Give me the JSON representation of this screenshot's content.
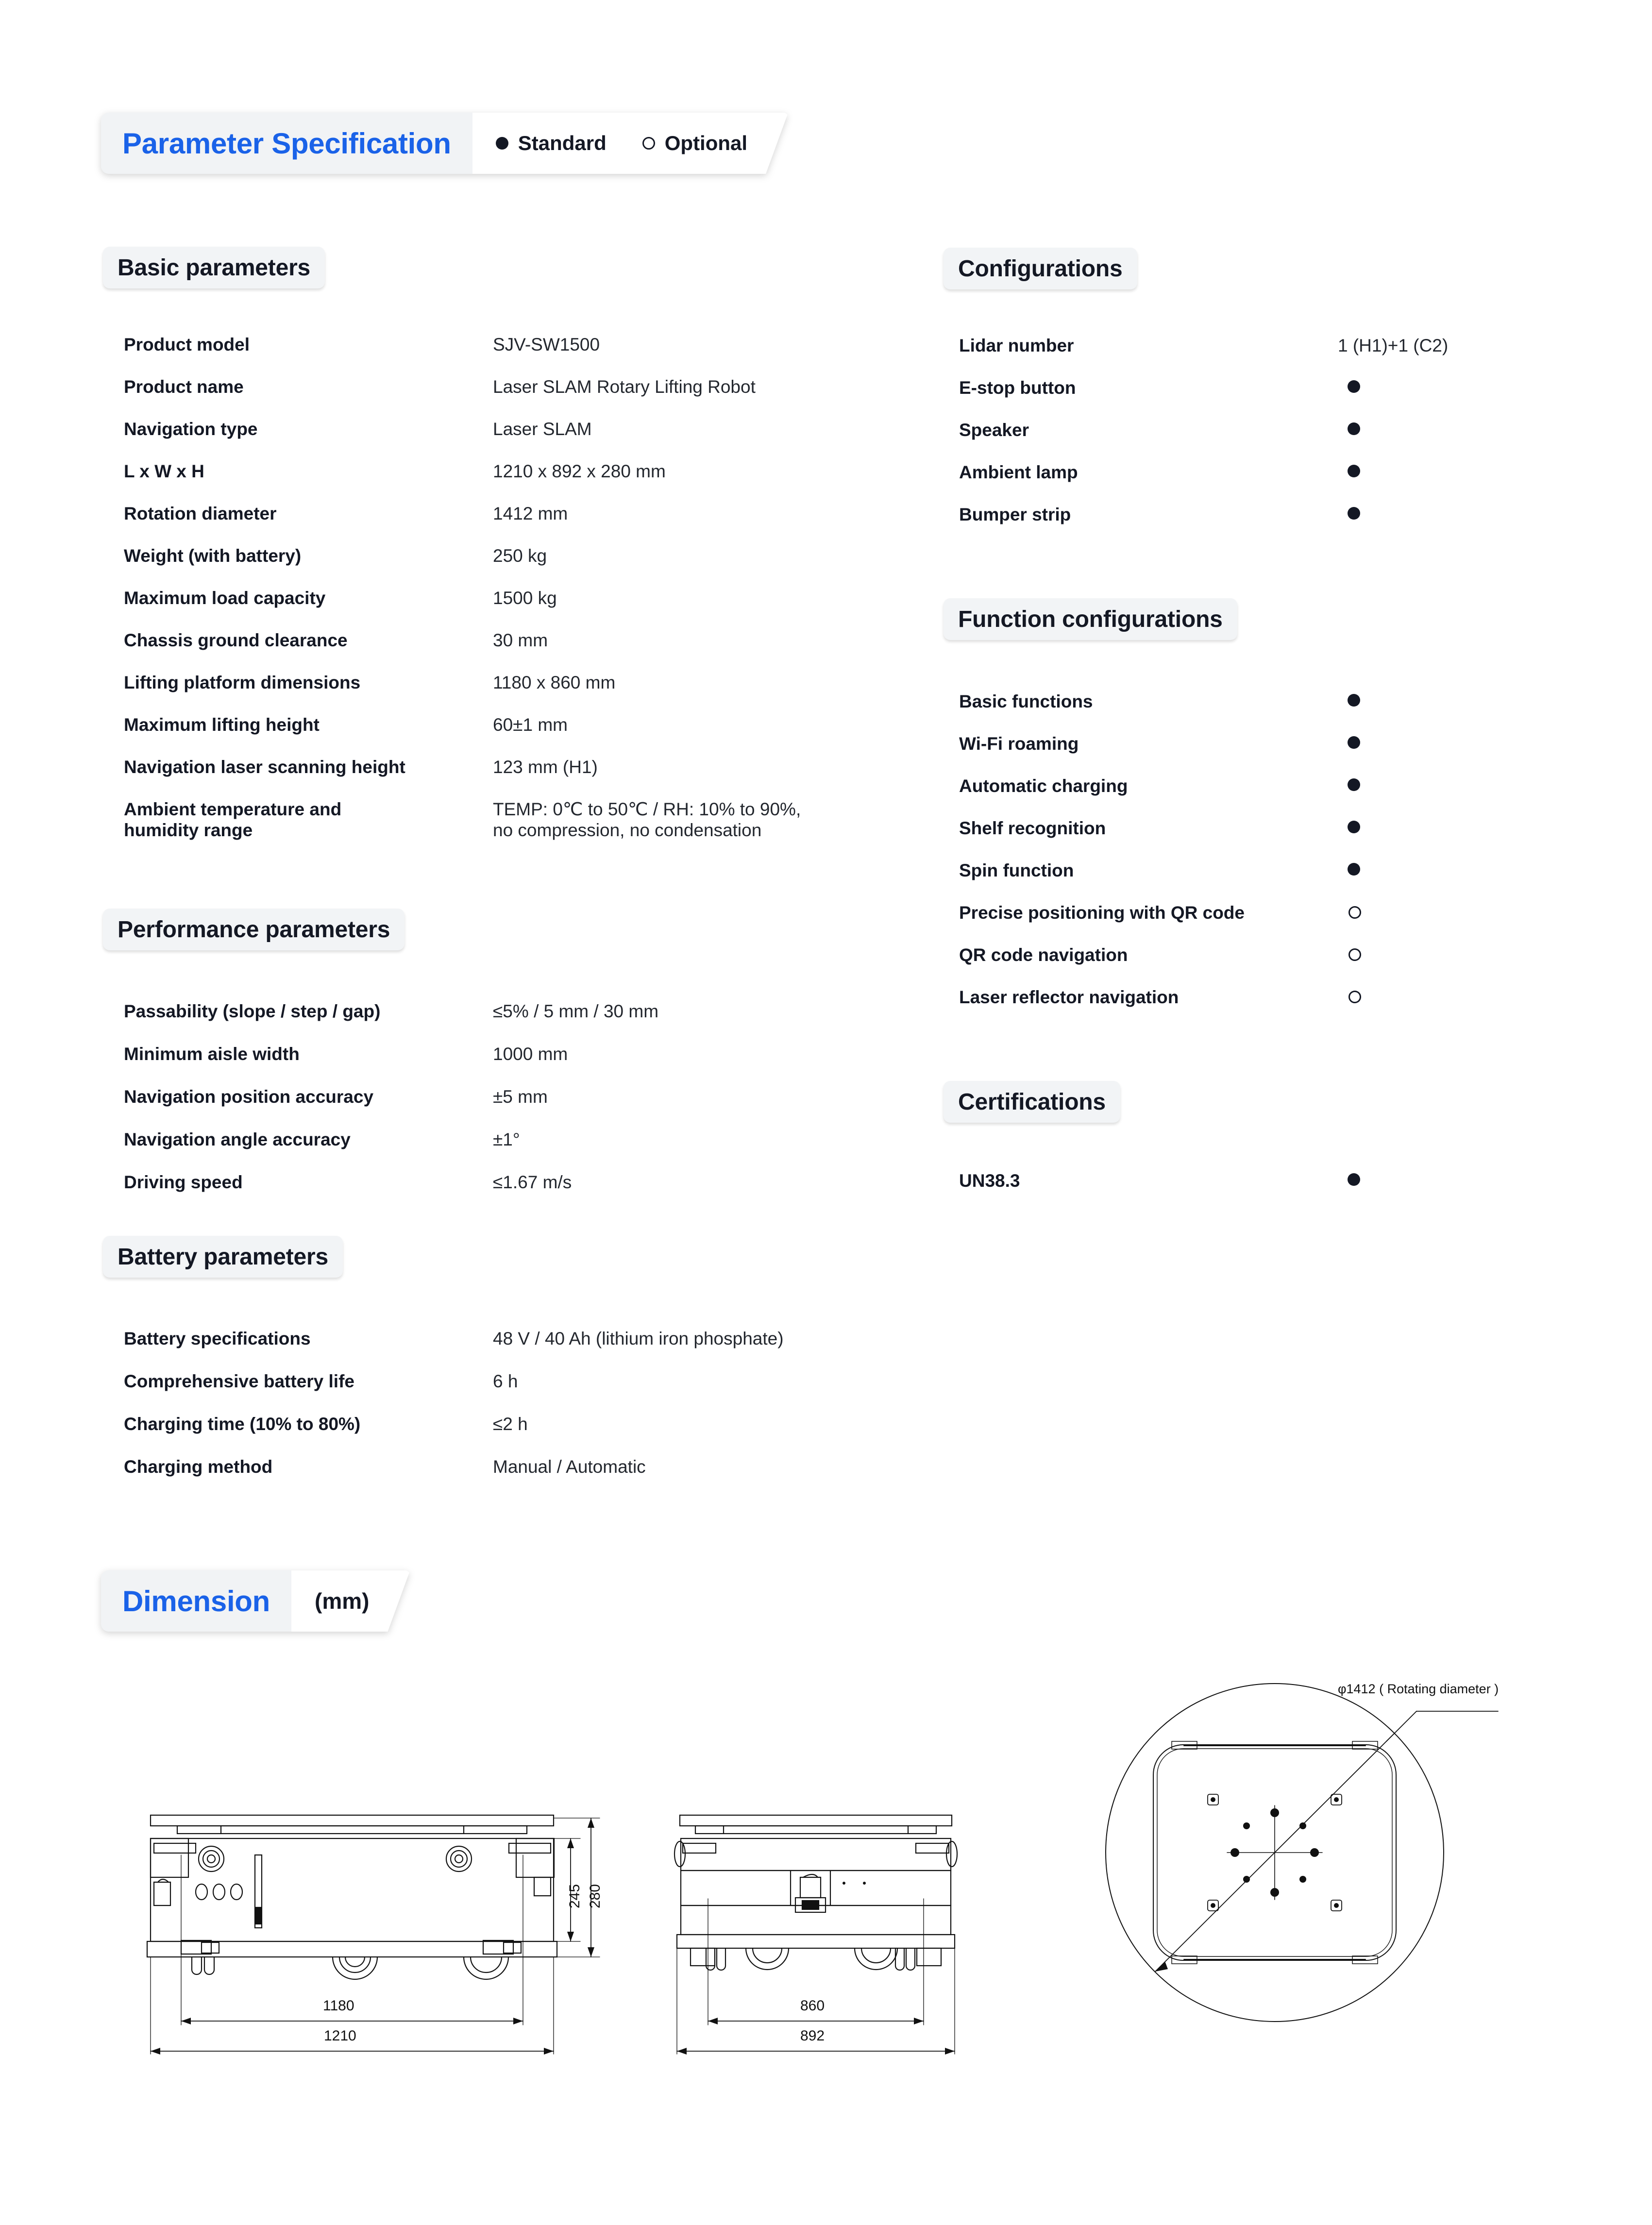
{
  "header": {
    "title": "Parameter Specification",
    "legend": [
      {
        "marker": "filled",
        "label": "Standard"
      },
      {
        "marker": "hollow",
        "label": "Optional"
      }
    ]
  },
  "sections": {
    "basic": {
      "title": "Basic parameters",
      "rows": [
        {
          "label": "Product model",
          "value": "SJV-SW1500"
        },
        {
          "label": "Product name",
          "value": "Laser SLAM Rotary Lifting Robot"
        },
        {
          "label": "Navigation type",
          "value": "Laser SLAM"
        },
        {
          "label": "L x W x H",
          "value": "1210 x 892 x 280 mm"
        },
        {
          "label": "Rotation diameter",
          "value": "1412 mm"
        },
        {
          "label": "Weight (with battery)",
          "value": "250 kg"
        },
        {
          "label": "Maximum load capacity",
          "value": "1500 kg"
        },
        {
          "label": "Chassis ground clearance",
          "value": "30 mm"
        },
        {
          "label": "Lifting platform dimensions",
          "value": "1180 x 860 mm"
        },
        {
          "label": "Maximum lifting height",
          "value": "60±1 mm"
        },
        {
          "label": "Navigation laser scanning height",
          "value": "123 mm (H1)"
        },
        {
          "label": "Ambient temperature and\nhumidity range",
          "value": "TEMP: 0℃ to 50℃ / RH: 10% to 90%,\nno compression, no condensation"
        }
      ]
    },
    "performance": {
      "title": "Performance parameters",
      "rows": [
        {
          "label": "Passability (slope / step / gap)",
          "value": "≤5% / 5 mm / 30 mm"
        },
        {
          "label": "Minimum aisle width",
          "value": "1000 mm"
        },
        {
          "label": "Navigation position accuracy",
          "value": "±5 mm"
        },
        {
          "label": "Navigation angle accuracy",
          "value": "±1°"
        },
        {
          "label": "Driving speed",
          "value": "≤1.67 m/s"
        }
      ]
    },
    "battery": {
      "title": "Battery parameters",
      "rows": [
        {
          "label": "Battery specifications",
          "value": "48 V / 40 Ah (lithium iron phosphate)"
        },
        {
          "label": "Comprehensive battery life",
          "value": "6 h"
        },
        {
          "label": "Charging time (10% to 80%)",
          "value": "≤2 h"
        },
        {
          "label": "Charging method",
          "value": "Manual / Automatic"
        }
      ]
    },
    "configurations": {
      "title": "Configurations",
      "rows": [
        {
          "label": "Lidar number",
          "value": "1 (H1)+1 (C2)",
          "marker": "none"
        },
        {
          "label": "E-stop button",
          "value": "",
          "marker": "filled"
        },
        {
          "label": "Speaker",
          "value": "",
          "marker": "filled"
        },
        {
          "label": "Ambient lamp",
          "value": "",
          "marker": "filled"
        },
        {
          "label": "Bumper strip",
          "value": "",
          "marker": "filled"
        }
      ]
    },
    "function_configurations": {
      "title": "Function configurations",
      "rows": [
        {
          "label": "Basic functions",
          "marker": "filled"
        },
        {
          "label": "Wi-Fi roaming",
          "marker": "filled"
        },
        {
          "label": "Automatic charging",
          "marker": "filled"
        },
        {
          "label": "Shelf recognition",
          "marker": "filled"
        },
        {
          "label": "Spin function",
          "marker": "filled"
        },
        {
          "label": "Precise positioning with QR code",
          "marker": "hollow"
        },
        {
          "label": "QR code navigation",
          "marker": "hollow"
        },
        {
          "label": "Laser reflector navigation",
          "marker": "hollow"
        }
      ]
    },
    "certifications": {
      "title": "Certifications",
      "rows": [
        {
          "label": "UN38.3",
          "marker": "filled"
        }
      ]
    }
  },
  "dimension": {
    "title": "Dimension",
    "unit": "(mm)",
    "side_view": {
      "length_inner": "1180",
      "length_outer": "1210",
      "height_inner": "245",
      "height_outer": "280"
    },
    "front_view": {
      "width_inner": "860",
      "width_outer": "892"
    },
    "top_view": {
      "note": "φ1412 ( Rotating diameter )"
    }
  },
  "colors": {
    "accent_blue": "#1a62e8",
    "pill_bg": "#f2f4f6",
    "text_dark": "#141824",
    "value_text": "#23272e",
    "line": "#111111"
  }
}
